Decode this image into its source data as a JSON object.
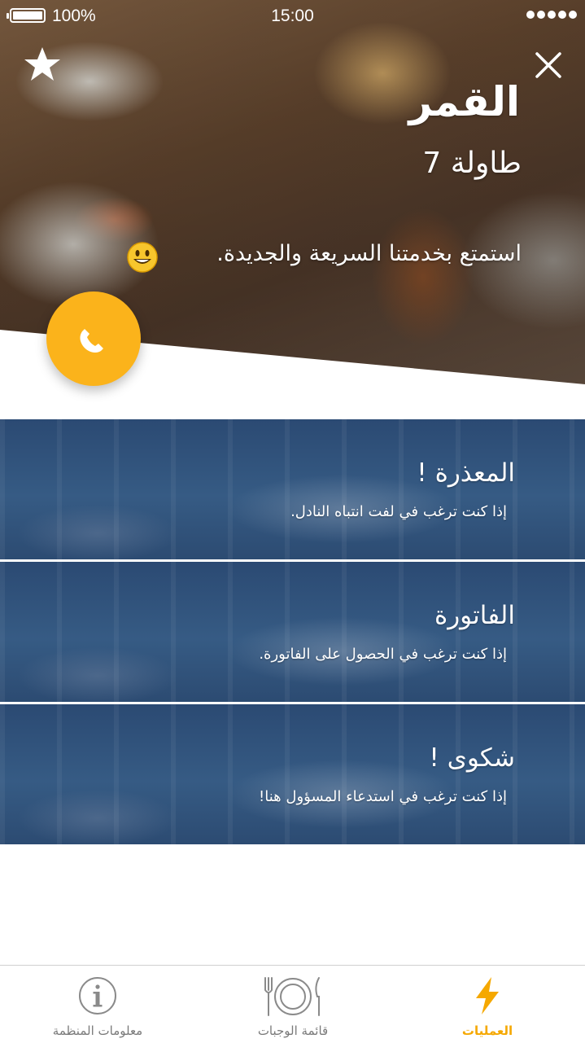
{
  "status_bar": {
    "battery": "100%",
    "time": "15:00"
  },
  "header": {
    "restaurant_name": "القمر",
    "table": "طاولة 7",
    "welcome": "استمتع بخدمتنا السريعة والجديدة."
  },
  "icons": {
    "favorite": "star-icon",
    "close": "close-icon",
    "call": "phone-icon",
    "emoji": "smiley-icon"
  },
  "accent_color": "#fbb31b",
  "options": [
    {
      "title": "المعذرة !",
      "subtitle": "إذا كنت ترغب في لفت انتباه النادل."
    },
    {
      "title": "الفاتورة",
      "subtitle": "إذا كنت ترغب في الحصول على الفاتورة."
    },
    {
      "title": "شكوى !",
      "subtitle": "إذا كنت ترغب في استدعاء المسؤول هنا!"
    }
  ],
  "tabs": [
    {
      "label": "معلومات المنظمة",
      "icon": "info-icon",
      "active": false
    },
    {
      "label": "قائمة الوجبات",
      "icon": "cutlery-plate-icon",
      "active": false
    },
    {
      "label": "العمليات",
      "icon": "lightning-icon",
      "active": true
    }
  ]
}
